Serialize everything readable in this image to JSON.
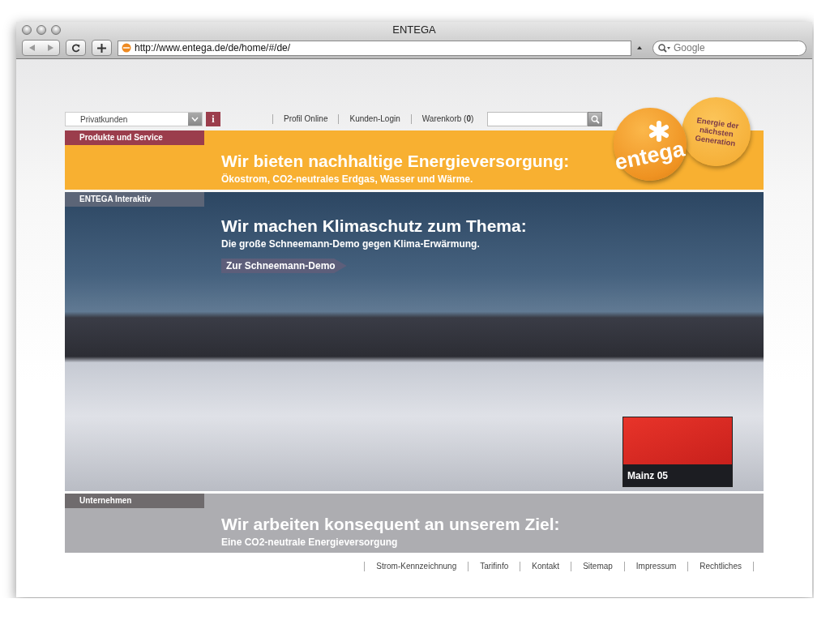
{
  "window": {
    "title": "ENTEGA"
  },
  "toolbar": {
    "url": "http://www.entega.de/de/home/#/de/",
    "search_placeholder": "Google"
  },
  "header": {
    "customer_select": "Privatkunden",
    "info_button": "i",
    "links": [
      "Profil Online",
      "Kunden-Login",
      "Warenkorb (**0**)"
    ]
  },
  "logo": {
    "wordmark": "entega",
    "tagline": "Energie der nächsten Generation"
  },
  "panels": [
    {
      "kind": "banner",
      "tab": "Produkte und Service",
      "color": "#9b3d4c",
      "headline": "Wir bieten nachhaltige Energieversorgung:",
      "subline": "Ökostrom, CO2-neutrales Erdgas, Wasser und Wärme."
    },
    {
      "kind": "photo",
      "tab": "ENTEGA Interaktiv",
      "color": "#5c6577",
      "headline": "Wir machen Klimaschutz zum Thema:",
      "subline": "Die große Schneemann-Demo gegen Klima-Erwärmung.",
      "link": "Zur Schneemann-Demo",
      "teaser": {
        "caption": "Mainz 05"
      }
    },
    {
      "kind": "gray",
      "tab": "Unternehmen",
      "color": "#6f6b6d",
      "headline": "Wir arbeiten konsequent an unserem Ziel:",
      "subline": "Eine CO2-neutrale Energieversorgung"
    }
  ],
  "footer_links": [
    "Strom-Kennzeichnung",
    "Tarifinfo",
    "Kontakt",
    "Sitemap",
    "Impressum",
    "Rechtliches"
  ]
}
